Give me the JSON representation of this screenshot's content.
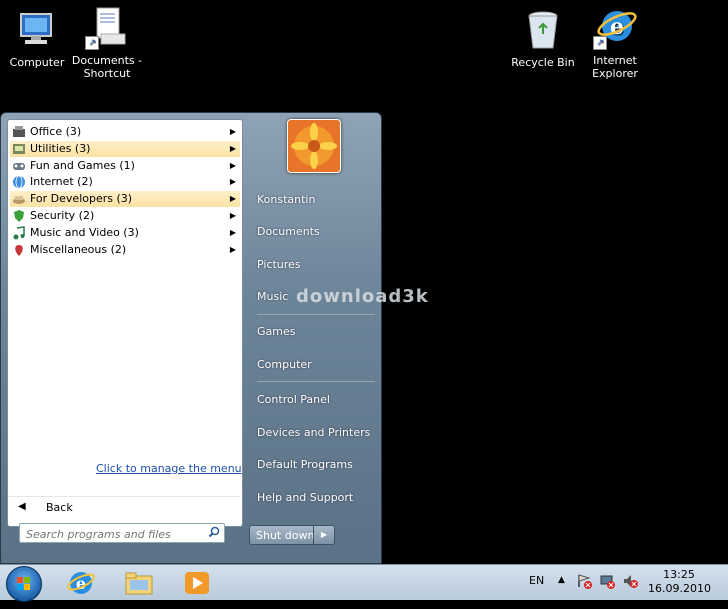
{
  "desktop": {
    "icons": [
      {
        "label": "Computer"
      },
      {
        "label": "Documents - Shortcut"
      },
      {
        "label": "Recycle Bin"
      },
      {
        "label": "Internet Explorer"
      }
    ]
  },
  "start_menu": {
    "programs": [
      {
        "label": "Office (3)",
        "highlighted": false
      },
      {
        "label": "Utilities (3)",
        "highlighted": true
      },
      {
        "label": "Fun and Games (1)",
        "highlighted": false
      },
      {
        "label": "Internet (2)",
        "highlighted": false
      },
      {
        "label": "For Developers (3)",
        "highlighted": true
      },
      {
        "label": "Security (2)",
        "highlighted": false
      },
      {
        "label": "Music and Video (3)",
        "highlighted": false
      },
      {
        "label": "Miscellaneous (2)",
        "highlighted": false
      }
    ],
    "manage_link": "Click to manage the menu",
    "back_label": "Back",
    "search_placeholder": "Search programs and files",
    "right_items": {
      "user": "Konstantin",
      "documents": "Documents",
      "pictures": "Pictures",
      "music": "Music",
      "games": "Games",
      "computer": "Computer",
      "control_panel": "Control Panel",
      "devices": "Devices and Printers",
      "default_programs": "Default Programs",
      "help": "Help and Support"
    },
    "shutdown_label": "Shut down"
  },
  "watermark": "download3k",
  "taskbar": {
    "language": "EN",
    "time": "13:25",
    "date": "16.09.2010"
  },
  "colors": {
    "highlight": "#fbe2a4",
    "link": "#1f4fa8",
    "menu_bg": "#6d8599"
  }
}
